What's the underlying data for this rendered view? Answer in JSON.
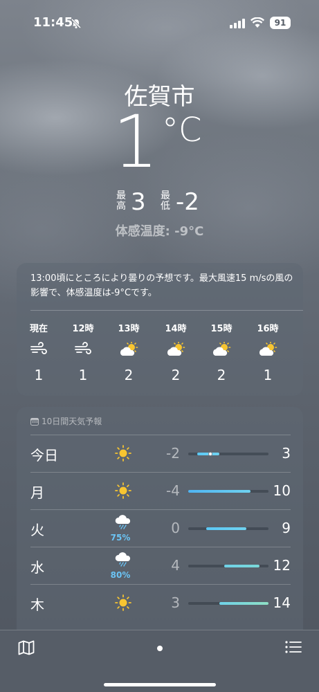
{
  "status_bar": {
    "time": "11:45",
    "battery": "91"
  },
  "location": {
    "city": "佐賀市"
  },
  "current": {
    "temp": "1",
    "unit": "°C",
    "high_label": "最高",
    "high": "3",
    "low_label": "最低",
    "low": "-2",
    "feels_like": "体感温度: -9°C"
  },
  "hourly": {
    "description": "13:00頃にところにより曇りの予想です。最大風速15 m/sの風の影響で、体感温度は-9°Cです。",
    "hours": [
      {
        "label": "現在",
        "icon": "wind-icon",
        "value": "1"
      },
      {
        "label": "12時",
        "icon": "wind-icon",
        "value": "1"
      },
      {
        "label": "13時",
        "icon": "partly-cloudy-icon",
        "value": "2"
      },
      {
        "label": "14時",
        "icon": "partly-cloudy-icon",
        "value": "2"
      },
      {
        "label": "15時",
        "icon": "partly-cloudy-icon",
        "value": "2"
      },
      {
        "label": "16時",
        "icon": "partly-cloudy-icon",
        "value": "1"
      }
    ]
  },
  "daily": {
    "header": "10日間天気予報",
    "range_min": -4,
    "range_max": 14,
    "days": [
      {
        "name": "今日",
        "icon": "sun-icon",
        "precip": "",
        "low": "-2",
        "high": "3",
        "current": 1,
        "color_from": "#5bc8f5",
        "color_to": "#6fd2f0"
      },
      {
        "name": "月",
        "icon": "sun-icon",
        "precip": "",
        "low": "-4",
        "high": "10",
        "color_from": "#4fb4f2",
        "color_to": "#6fd2f0"
      },
      {
        "name": "火",
        "icon": "rain-cloud-icon",
        "precip": "75%",
        "low": "0",
        "high": "9",
        "color_from": "#5bc8f5",
        "color_to": "#6fd2f0"
      },
      {
        "name": "水",
        "icon": "rain-cloud-icon",
        "precip": "80%",
        "low": "4",
        "high": "12",
        "color_from": "#6fd2e8",
        "color_to": "#7ad8d8"
      },
      {
        "name": "木",
        "icon": "sun-icon",
        "precip": "",
        "low": "3",
        "high": "14",
        "color_from": "#6fd2e8",
        "color_to": "#8edfc4"
      }
    ]
  }
}
